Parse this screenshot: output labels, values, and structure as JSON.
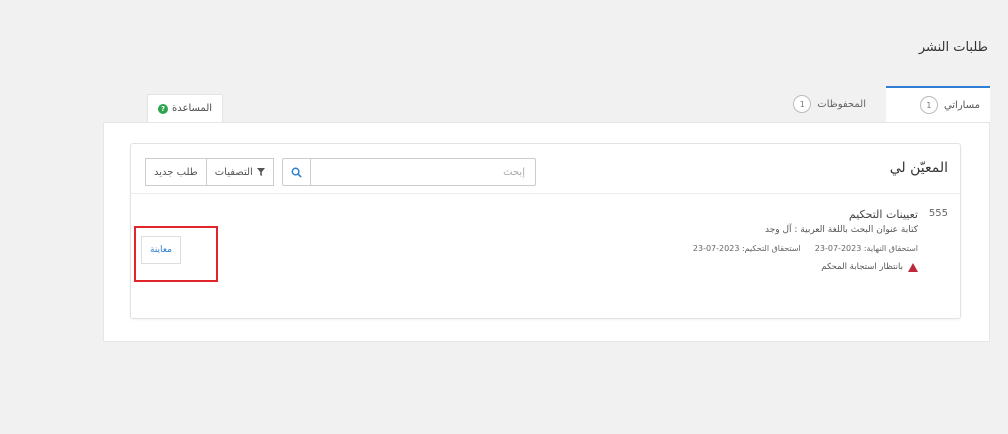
{
  "page": {
    "title": "طلبات النشر"
  },
  "tabs": [
    {
      "label": "مساراتي",
      "count": "1",
      "active": true
    },
    {
      "label": "المحفوظات",
      "count": "1",
      "active": false
    }
  ],
  "help_tab": {
    "label": "المساعدة"
  },
  "card": {
    "title": "المعيّن لي",
    "search": {
      "placeholder": "إبحث"
    },
    "filter_button": "التصفيات",
    "new_request_button": "طلب جديد"
  },
  "item": {
    "number": "555",
    "title": "تعيينات التحكيم",
    "subtitle": "كتابة عنوان البحث باللغة العربية : آل وجد",
    "due_final": "استحقاق النهاية: 2023-07-23",
    "due_review": "استحقاق التحكيم: 2023-07-23",
    "status": "بانتظار استجابة المحكم",
    "preview_button": "معاينة"
  },
  "colors": {
    "accent": "#2f7fd6",
    "warning": "#c0283b",
    "highlight": "#e0252b",
    "help": "#2ea44f"
  },
  "icons": {
    "search": "search-icon",
    "filter": "filter-icon",
    "warning": "warning-icon",
    "help": "help-icon"
  }
}
